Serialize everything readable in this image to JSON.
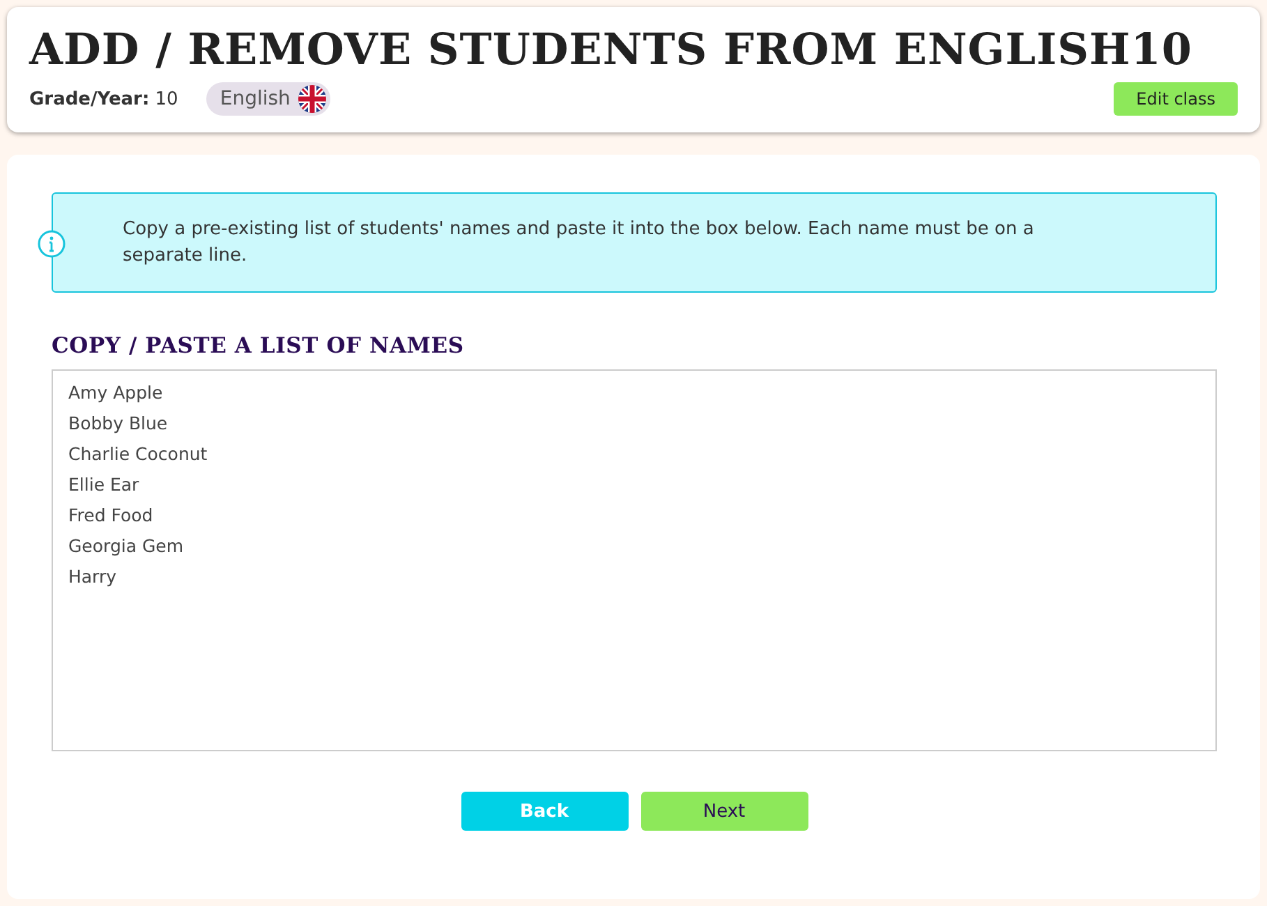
{
  "header": {
    "title": "ADD / REMOVE STUDENTS FROM ENGLISH10",
    "grade_label": "Grade/Year:",
    "grade_value": "10",
    "subject": "English",
    "edit_button": "Edit class"
  },
  "info": {
    "text": "Copy a pre-existing list of students' names and paste it into the box below. Each name must be on a separate line."
  },
  "section_title": "COPY / PASTE A LIST OF NAMES",
  "names": [
    "Amy Apple",
    "Bobby Blue",
    "Charlie Coconut",
    "Ellie Ear",
    "Fred Food",
    "Georgia Gem",
    "Harry"
  ],
  "buttons": [
    {
      "label": "Back",
      "kind": "back"
    },
    {
      "label": "Next",
      "kind": "next"
    }
  ]
}
